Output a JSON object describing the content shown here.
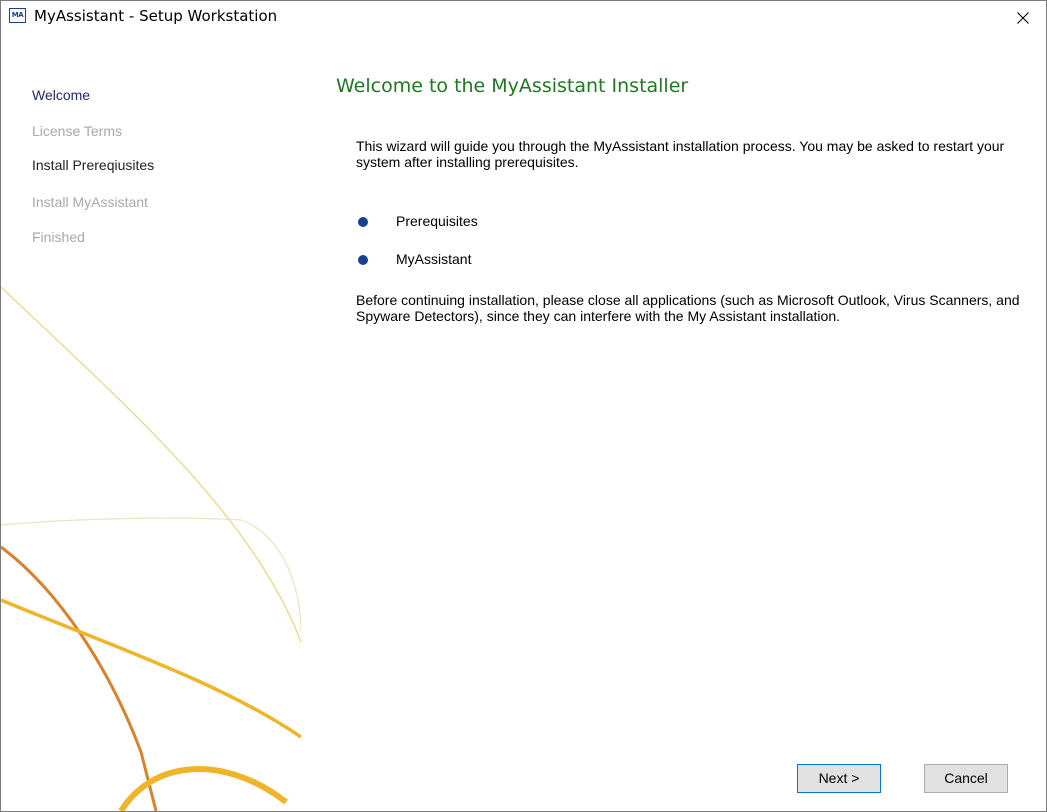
{
  "window": {
    "icon_text": "MA",
    "title": "MyAssistant - Setup Workstation"
  },
  "sidebar": {
    "items": [
      {
        "label": "Welcome",
        "state": "active"
      },
      {
        "label": "License Terms",
        "state": "disabled"
      },
      {
        "label": "Install Prereqiusites",
        "state": "enabled"
      },
      {
        "label": "Install MyAssistant",
        "state": "disabled"
      },
      {
        "label": "Finished",
        "state": "disabled"
      }
    ]
  },
  "main": {
    "heading": "Welcome to the MyAssistant Installer",
    "intro": "This wizard will guide you through the MyAssistant installation process. You may be asked to restart your system after installing prerequisites.",
    "bullets": [
      "Prerequisites",
      "MyAssistant"
    ],
    "warning": "Before continuing installation, please close all applications (such as Microsoft Outlook, Virus Scanners, and Spyware Detectors), since they can interfere with the My Assistant installation."
  },
  "buttons": {
    "next": "Next >",
    "cancel": "Cancel"
  },
  "colors": {
    "heading": "#1e7a1e",
    "bullet": "#1a3f8f",
    "active_nav": "#1f2a6b",
    "disabled_nav": "#a8a8a8",
    "deco_gold": "#f0b429",
    "deco_orange": "#d9822b",
    "deco_light": "#eadfb0"
  }
}
